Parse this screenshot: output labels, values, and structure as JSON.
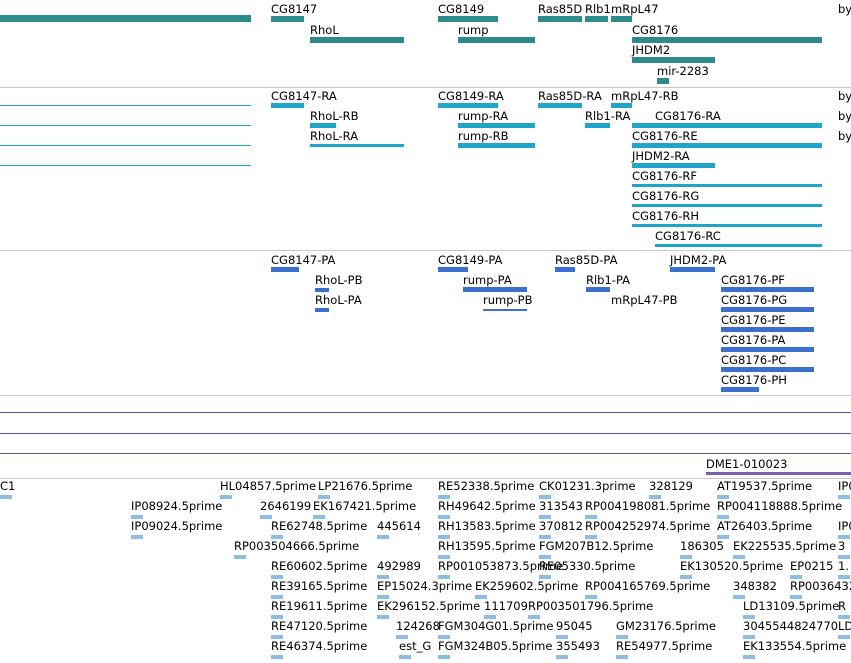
{
  "colors": {
    "gene": "#2e8b8b",
    "transcript": "#1ea5c9",
    "protein": "#3a6fd0",
    "est": "#8cbde6",
    "purple_line": "#6a4fa0",
    "divider": "#c8c8c8",
    "dme_marker": "#7a5cb0"
  },
  "genes": [
    {
      "label": "CG8147"
    },
    {
      "label": "RhoL"
    },
    {
      "label": "CG8149"
    },
    {
      "label": "rump"
    },
    {
      "label": "Ras85D"
    },
    {
      "label": "Rlb1"
    },
    {
      "label": "mRpL47"
    },
    {
      "label": "CG8176"
    },
    {
      "label": "JHDM2"
    },
    {
      "label": "mir-2283"
    },
    {
      "label": "by"
    }
  ],
  "transcripts": [
    {
      "label": "CG8147-RA"
    },
    {
      "label": "CG8149-RA"
    },
    {
      "label": "Ras85D-RA"
    },
    {
      "label": "mRpL47-RB"
    },
    {
      "label": "RhoL-RB"
    },
    {
      "label": "rump-RA"
    },
    {
      "label": "Rlb1-RA"
    },
    {
      "label": "CG8176-RA"
    },
    {
      "label": "RhoL-RA"
    },
    {
      "label": "rump-RB"
    },
    {
      "label": "CG8176-RE"
    },
    {
      "label": "JHDM2-RA"
    },
    {
      "label": "CG8176-RF"
    },
    {
      "label": "CG8176-RG"
    },
    {
      "label": "CG8176-RH"
    },
    {
      "label": "CG8176-RC"
    },
    {
      "label": "by"
    },
    {
      "label": "by"
    },
    {
      "label": "by"
    }
  ],
  "proteins": [
    {
      "label": "CG8147-PA"
    },
    {
      "label": "CG8149-PA"
    },
    {
      "label": "Ras85D-PA"
    },
    {
      "label": "JHDM2-PA"
    },
    {
      "label": "RhoL-PB"
    },
    {
      "label": "rump-PA"
    },
    {
      "label": "Rlb1-PA"
    },
    {
      "label": "CG8176-PF"
    },
    {
      "label": "RhoL-PA"
    },
    {
      "label": "rump-PB"
    },
    {
      "label": "mRpL47-PB"
    },
    {
      "label": "CG8176-PG"
    },
    {
      "label": "CG8176-PE"
    },
    {
      "label": "CG8176-PA"
    },
    {
      "label": "CG8176-PC"
    },
    {
      "label": "CG8176-PH"
    }
  ],
  "dme_label": "DME1-010023",
  "ests": [
    {
      "label": "C1"
    },
    {
      "label": "HL04857.5prime"
    },
    {
      "label": "LP21676.5prime"
    },
    {
      "label": "RE52338.5prime"
    },
    {
      "label": "CK01231.3prime"
    },
    {
      "label": "328129"
    },
    {
      "label": "AT19537.5prime"
    },
    {
      "label": "IP0"
    },
    {
      "label": "IP08924.5prime"
    },
    {
      "label": "2646199"
    },
    {
      "label": "EK167421.5prime"
    },
    {
      "label": "RH49642.5prime"
    },
    {
      "label": "313543"
    },
    {
      "label": "RP004198081.5prime"
    },
    {
      "label": "RP004118888.5prime"
    },
    {
      "label": "IP09024.5prime"
    },
    {
      "label": "RE62748.5prime"
    },
    {
      "label": "445614"
    },
    {
      "label": "RH13583.5prime"
    },
    {
      "label": "370812"
    },
    {
      "label": "RP004252974.5prime"
    },
    {
      "label": "AT26403.5prime"
    },
    {
      "label": "IP0"
    },
    {
      "label": "RP003504666.5prime"
    },
    {
      "label": "RH13595.5prime"
    },
    {
      "label": "FGM207B12.5prime"
    },
    {
      "label": "186305"
    },
    {
      "label": "EK225535.5prime"
    },
    {
      "label": "3"
    },
    {
      "label": "RE60602.5prime"
    },
    {
      "label": "492989"
    },
    {
      "label": "RP001053873.5prime"
    },
    {
      "label": "RE05330.5prime"
    },
    {
      "label": "EK130520.5prime"
    },
    {
      "label": "EP0215"
    },
    {
      "label": "1."
    },
    {
      "label": "RE39165.5prime"
    },
    {
      "label": "EP15024.3prime"
    },
    {
      "label": "EK259602.5prime"
    },
    {
      "label": "RP004165769.5prime"
    },
    {
      "label": "348382"
    },
    {
      "label": "RP0036432"
    },
    {
      "label": "RE19611.5prime"
    },
    {
      "label": "EK296152.5prime"
    },
    {
      "label": "111709"
    },
    {
      "label": "RP003501796.5prime"
    },
    {
      "label": "LD13109.5prime"
    },
    {
      "label": "R"
    },
    {
      "label": "RE47120.5prime"
    },
    {
      "label": "124268"
    },
    {
      "label": "FGM304G01.5prime"
    },
    {
      "label": "95045"
    },
    {
      "label": "GM23176.5prime"
    },
    {
      "label": "3045544824770"
    },
    {
      "label": "LD"
    },
    {
      "label": "RE46374.5prime"
    },
    {
      "label": "est_G"
    },
    {
      "label": "FGM324B05.5prime"
    },
    {
      "label": "355493"
    },
    {
      "label": "RE54977.5prime"
    },
    {
      "label": "EK133554.5prime"
    }
  ]
}
